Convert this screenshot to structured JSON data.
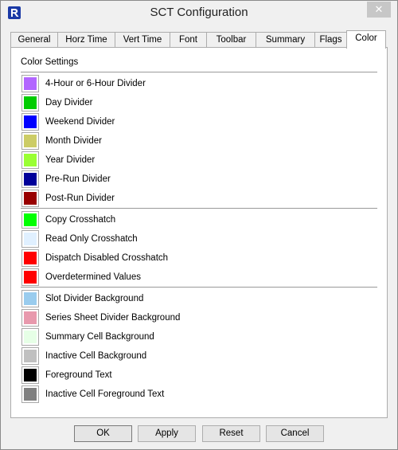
{
  "window": {
    "title": "SCT Configuration",
    "close_glyph": "✕"
  },
  "tabs": [
    {
      "label": "General"
    },
    {
      "label": "Horz Time"
    },
    {
      "label": "Vert Time"
    },
    {
      "label": "Font"
    },
    {
      "label": "Toolbar"
    },
    {
      "label": "Summary"
    },
    {
      "label": "Flags"
    },
    {
      "label": "Color",
      "active": true
    }
  ],
  "panel": {
    "section_title": "Color Settings"
  },
  "groups": [
    [
      {
        "label": "4-Hour or 6-Hour Divider",
        "color": "#b266ff"
      },
      {
        "label": "Day Divider",
        "color": "#00cc00"
      },
      {
        "label": "Weekend Divider",
        "color": "#0000ff"
      },
      {
        "label": "Month Divider",
        "color": "#cccc66"
      },
      {
        "label": "Year Divider",
        "color": "#99ff33"
      },
      {
        "label": "Pre-Run Divider",
        "color": "#000099"
      },
      {
        "label": "Post-Run Divider",
        "color": "#990000"
      }
    ],
    [
      {
        "label": "Copy Crosshatch",
        "color": "#00ff00"
      },
      {
        "label": "Read Only Crosshatch",
        "color": "#e0f0ff"
      },
      {
        "label": "Dispatch Disabled Crosshatch",
        "color": "#ff0000"
      },
      {
        "label": "Overdetermined Values",
        "color": "#ff0000"
      }
    ],
    [
      {
        "label": "Slot Divider Background",
        "color": "#99ccee"
      },
      {
        "label": "Series Sheet Divider Background",
        "color": "#e899ad"
      },
      {
        "label": "Summary Cell Background",
        "color": "#e6ffe6"
      },
      {
        "label": "Inactive Cell Background",
        "color": "#c0c0c0"
      },
      {
        "label": "Foreground Text",
        "color": "#000000"
      },
      {
        "label": "Inactive Cell Foreground Text",
        "color": "#808080"
      }
    ]
  ],
  "buttons": {
    "ok": "OK",
    "apply": "Apply",
    "reset": "Reset",
    "cancel": "Cancel"
  }
}
